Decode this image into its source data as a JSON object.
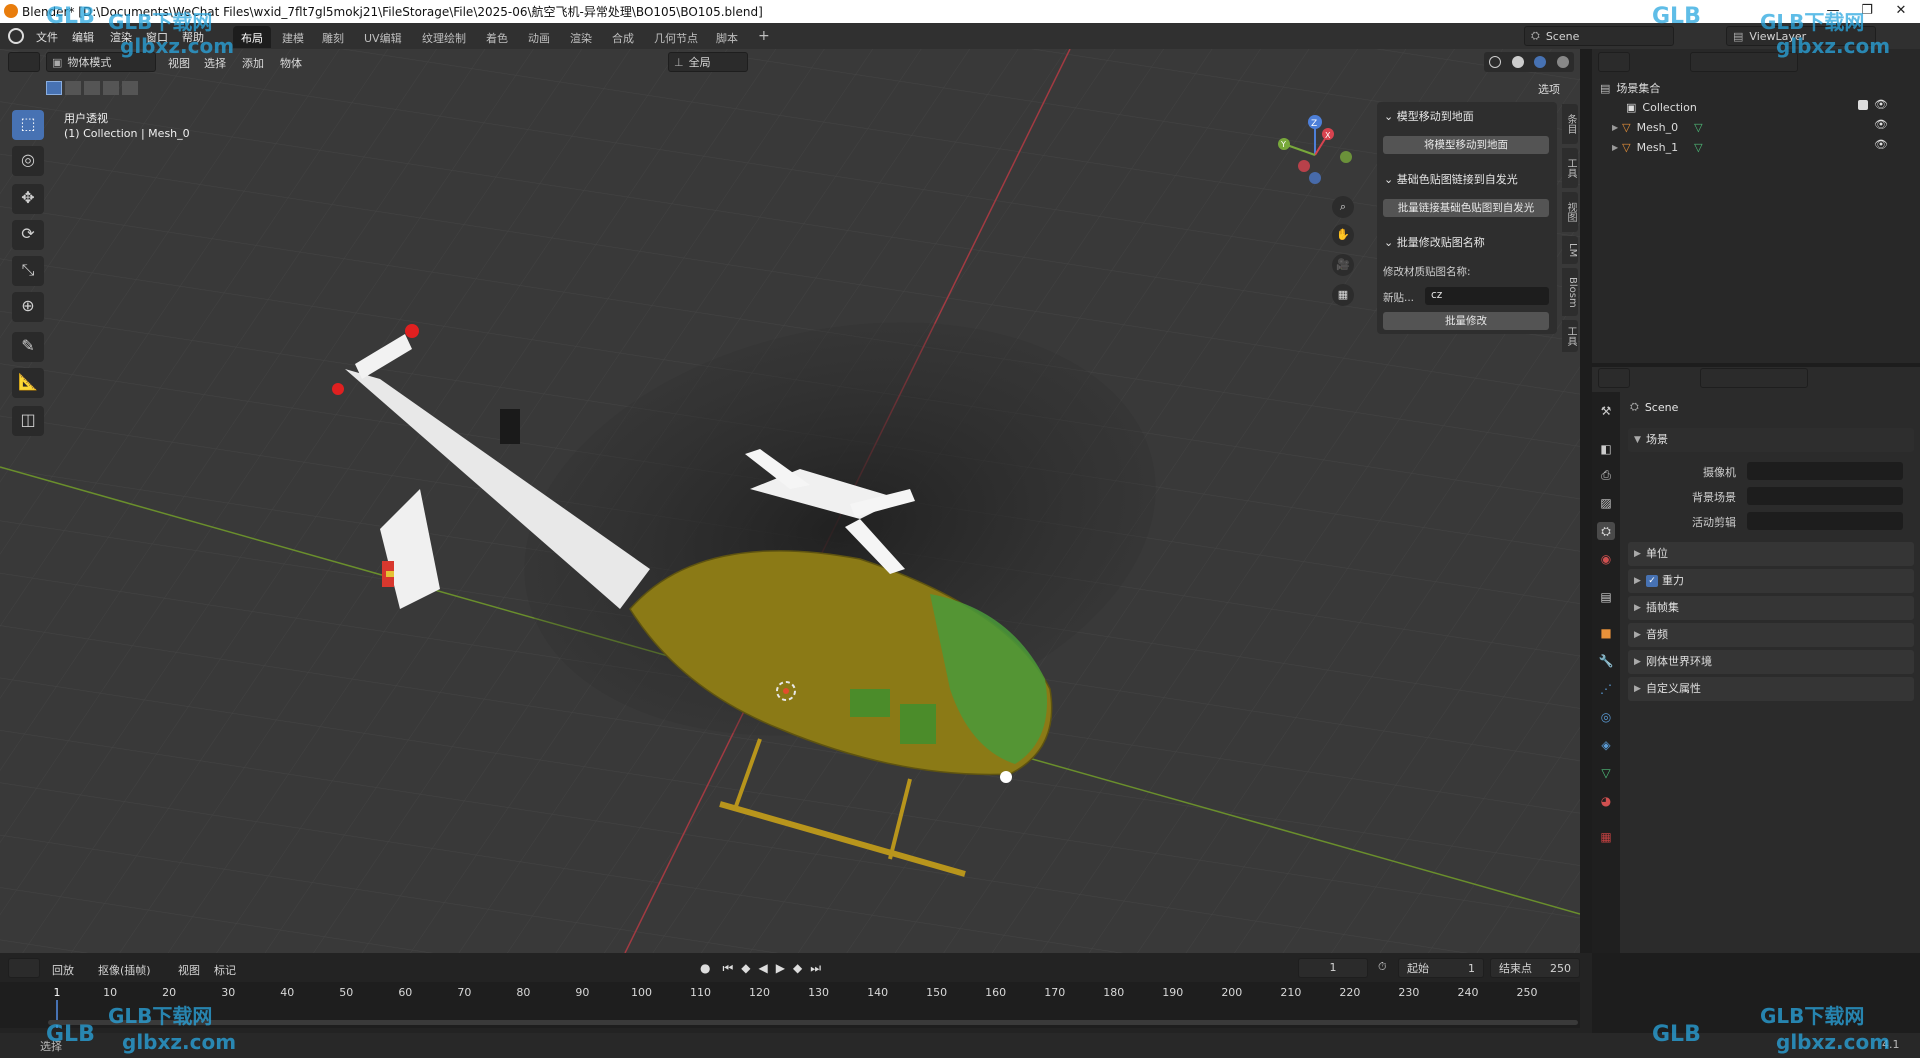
{
  "window": {
    "title": "Blender* [D:\\Documents\\WeChat Files\\wxid_7flt7gl5mokj21\\FileStorage\\File\\2025-06\\航空飞机-异常处理\\BO105\\BO105.blend]",
    "controls": [
      "—",
      "❐",
      "✕"
    ]
  },
  "menu": [
    "文件",
    "编辑",
    "渲染",
    "窗口",
    "帮助"
  ],
  "workspaces": [
    "布局",
    "建模",
    "雕刻",
    "UV编辑",
    "纹理绘制",
    "着色",
    "动画",
    "渲染",
    "合成",
    "几何节点",
    "脚本"
  ],
  "active_workspace": "布局",
  "add_workspace": "+",
  "scene_selector": {
    "label": "Scene"
  },
  "viewlayer_selector": {
    "label": "ViewLayer"
  },
  "viewport_header": {
    "mode": "物体模式",
    "items": [
      "视图",
      "选择",
      "添加",
      "物体"
    ],
    "transform_orientation": "全局",
    "options": "选项"
  },
  "viewport": {
    "view_name": "用户透视",
    "collection_info": "(1) Collection | Mesh_0",
    "colors": {
      "bg": "#393939",
      "grid": "#454545",
      "x_axis": "#a23a42",
      "y_axis": "#6a8f2c",
      "body": "#8b7a16",
      "accent": "#4a9a3a"
    }
  },
  "tools": [
    "select-box",
    "cursor",
    "move",
    "rotate",
    "scale",
    "transform",
    "annotate",
    "measure",
    "add-cube"
  ],
  "gizmo": {
    "labels": [
      "Z",
      "X",
      "Y"
    ]
  },
  "npanel": {
    "sections": [
      {
        "title": "模型移动到地面",
        "button": "将模型移动到地面"
      },
      {
        "title": "基础色贴图链接到自发光",
        "button": "批量链接基础色贴图到自发光"
      },
      {
        "title": "批量修改贴图名称"
      }
    ],
    "rename_label": "修改材质贴图名称:",
    "new_label": "新贴...",
    "new_value": "cz",
    "batch_button": "批量修改",
    "tabs": [
      "条目",
      "工具",
      "视图",
      "LM",
      "Blosm",
      "工具"
    ]
  },
  "outliner": {
    "root": "场景集合",
    "items": [
      {
        "name": "Collection",
        "type": "collection"
      },
      {
        "name": "Mesh_0",
        "type": "mesh"
      },
      {
        "name": "Mesh_1",
        "type": "mesh"
      }
    ]
  },
  "properties": {
    "title": "Scene",
    "scene_section": "场景",
    "fields": [
      {
        "label": "摄像机",
        "value": ""
      },
      {
        "label": "背景场景",
        "value": ""
      },
      {
        "label": "活动剪辑",
        "value": ""
      }
    ],
    "sections": [
      "单位",
      "重力",
      "插帧集",
      "音频",
      "刚体世界环境",
      "自定义属性"
    ],
    "gravity_checked": true
  },
  "timeline": {
    "menus": [
      "回放",
      "抠像(插帧)",
      "视图",
      "标记"
    ],
    "current_frame": "1",
    "start_label": "起始",
    "start_value": "1",
    "end_label": "结束点",
    "end_value": "250",
    "ticks": [
      "1",
      "10",
      "20",
      "30",
      "40",
      "50",
      "60",
      "70",
      "80",
      "90",
      "100",
      "110",
      "120",
      "130",
      "140",
      "150",
      "160",
      "170",
      "180",
      "190",
      "200",
      "210",
      "220",
      "230",
      "240",
      "250"
    ]
  },
  "status": {
    "left": "选择",
    "version": "4.1"
  },
  "watermarks": {
    "brand": "GLB下载网",
    "url": "glbxz.com",
    "logo": "GLB"
  }
}
